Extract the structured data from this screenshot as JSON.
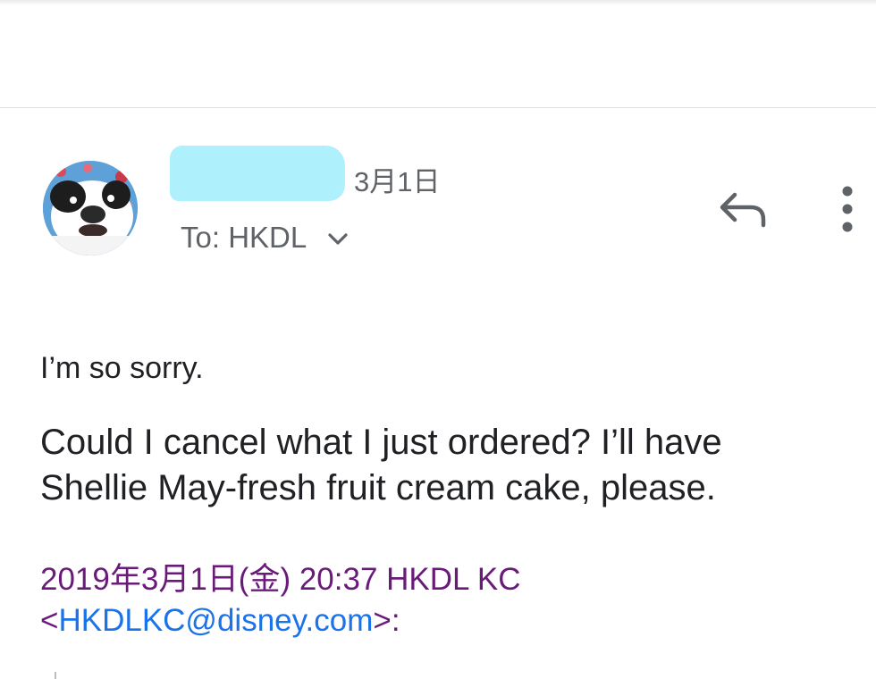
{
  "message": {
    "date": "3月1日",
    "recipient_prefix": "To: ",
    "recipient": "HKDL",
    "body_line1": "I’m so sorry.",
    "body_paragraph2": "Could I cancel what I just ordered? I’ll have Shellie May-fresh fruit cream cake, please."
  },
  "quoted": {
    "header_line": "2019年3月1日(金) 20:37 HKDL KC",
    "open_bracket": "<",
    "email": "HKDLKC@disney.com",
    "close_suffix": ">:"
  },
  "icons": {
    "reply": "reply-arrow-icon",
    "more": "more-vertical-icon",
    "expand": "chevron-down-icon"
  },
  "colors": {
    "redaction": "#aef0fb",
    "quote_text": "#6a1b7a",
    "link": "#1a73e8"
  }
}
